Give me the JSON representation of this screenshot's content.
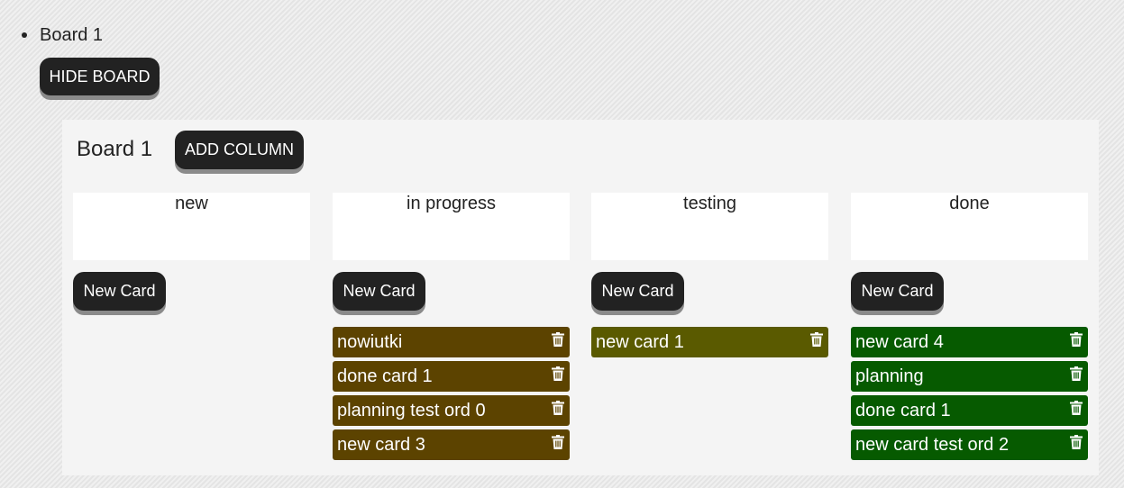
{
  "list": {
    "board_name": "Board 1",
    "hide_button": "HIDE BOARD"
  },
  "board": {
    "title": "Board 1",
    "add_column_button": "ADD COLUMN",
    "new_card_label": "New Card",
    "colors": {
      "in_progress": "#5c4300",
      "testing": "#5a5a00",
      "done": "#065a00"
    },
    "columns": [
      {
        "title": "new",
        "cards": []
      },
      {
        "title": "in progress",
        "cards": [
          "nowiutki",
          "done card 1",
          "planning test ord 0",
          "new card 3"
        ]
      },
      {
        "title": "testing",
        "cards": [
          "new card 1"
        ]
      },
      {
        "title": "done",
        "cards": [
          "new card 4",
          "planning",
          "done card 1",
          "new card test ord 2"
        ]
      }
    ]
  }
}
